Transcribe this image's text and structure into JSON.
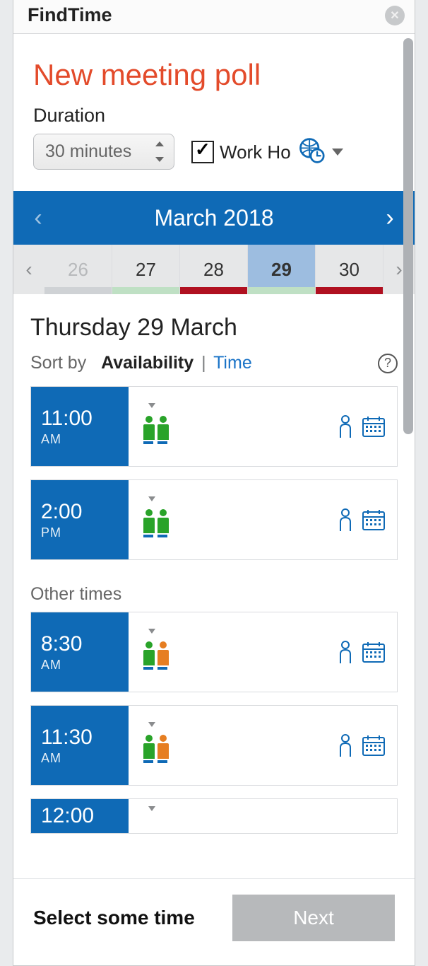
{
  "titlebar": {
    "title": "FindTime"
  },
  "heading": "New meeting poll",
  "duration": {
    "label": "Duration",
    "value": "30 minutes"
  },
  "workHours": {
    "label": "Work Ho",
    "checked": true
  },
  "month": {
    "label": "March 2018"
  },
  "days": [
    {
      "num": "26",
      "barColor": "grey",
      "disabled": true
    },
    {
      "num": "27",
      "barColor": "green"
    },
    {
      "num": "28",
      "barColor": "red"
    },
    {
      "num": "29",
      "barColor": "green",
      "selected": true
    },
    {
      "num": "30",
      "barColor": "red"
    }
  ],
  "dateHeading": "Thursday 29 March",
  "sort": {
    "prefix": "Sort by",
    "active": "Availability",
    "other": "Time"
  },
  "slotsTop": [
    {
      "time": "11:00",
      "ampm": "AM",
      "people": [
        "green",
        "green"
      ]
    },
    {
      "time": "2:00",
      "ampm": "PM",
      "people": [
        "green",
        "green"
      ]
    }
  ],
  "otherHeading": "Other times",
  "slotsOther": [
    {
      "time": "8:30",
      "ampm": "AM",
      "people": [
        "green",
        "orange"
      ]
    },
    {
      "time": "11:30",
      "ampm": "AM",
      "people": [
        "green",
        "orange"
      ]
    },
    {
      "time": "12:00",
      "ampm": "",
      "people": []
    }
  ],
  "footer": {
    "text": "Select some time",
    "button": "Next"
  },
  "colors": {
    "primary": "#0f6ab6",
    "accentRed": "#e34b2b"
  }
}
